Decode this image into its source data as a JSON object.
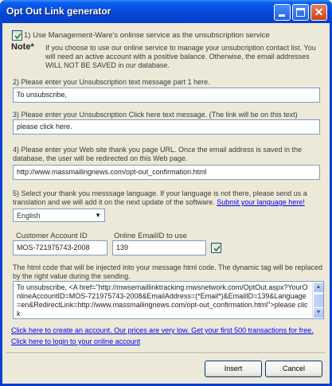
{
  "window": {
    "title": "Opt Out Link generator"
  },
  "option1": {
    "checked": true,
    "label": "1) Use Management-Ware's onlinse service as the unsubscription service"
  },
  "note": {
    "label": "Note*",
    "text": "If you choose to use our online service to manage your unsubcription contact list. You will need an active account with a  positive balance. Otherwise, the email addresses WILL NOT BE SAVED in our database."
  },
  "step2": {
    "label": "2) Please enter your Unsubscription  text message part 1 here.",
    "value": "To unsubscribe,"
  },
  "step3": {
    "label": "3) Please enter your Unsubscription Click here text message. (The link will be on this text)",
    "value": "please click here."
  },
  "step4": {
    "label": "4) Please enter your Web site thank you page URL. Once the email address is saved in the database, the user will be redirected on this Web page.",
    "value": "http://www.massmailingnews.com/opt-out_confirmation.html"
  },
  "step5": {
    "label": "5) Select your thank you messsage language. If your language is not there, please send us a translation and we will add it on the next update of the software.",
    "link": "Submit your language here!",
    "language": "English"
  },
  "account": {
    "label": "Customer Account ID",
    "value": "MOS-721975743-2008"
  },
  "emailid": {
    "label": "Online EmailID to use",
    "value": "139",
    "checked": true
  },
  "htmlcode": {
    "label": "The html code that will be injected into your message html code. The dynamic tag will be replaced by the right value during the sending.",
    "value": "To unsubscribe, <A href=\"http://mwsemaillinktracking.mwsnetwork.com/OptOut.aspx?YourOnlineAccountID=MOS-721975743-2008&EmailAddress=(*Email*)&EmailID=139&Language=en&RedirectLink=http://www.massmailingnews.com/opt-out_confirmation.html\">please click"
  },
  "links": {
    "create": "Click here to create an account. Our prices are very low. Get your first 500 transactions for free.",
    "login": "Click here to login to your online account"
  },
  "buttons": {
    "insert": "Insert",
    "cancel": "Cancel"
  },
  "colors": {
    "titlebar": "#0A3FD4",
    "link": "#0000FF",
    "background": "#ECE9D8"
  }
}
